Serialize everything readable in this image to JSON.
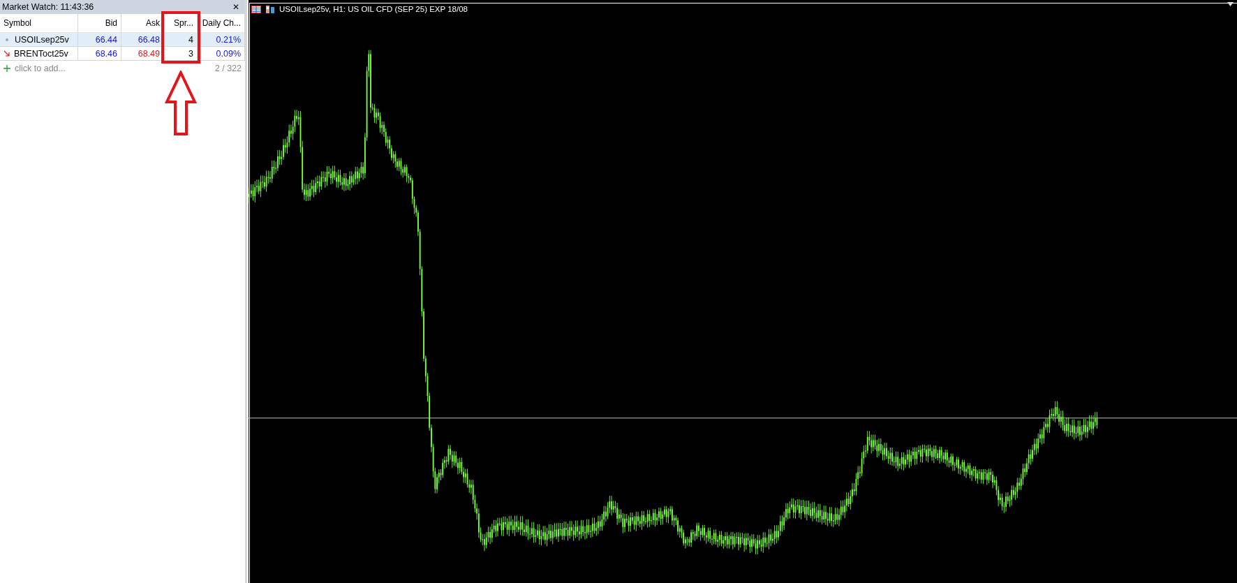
{
  "market_watch": {
    "title": "Market Watch: 11:43:36",
    "close_glyph": "✕",
    "columns": [
      {
        "label": "Symbol",
        "highlighted": false
      },
      {
        "label": "Bid",
        "highlighted": false
      },
      {
        "label": "Ask",
        "highlighted": false
      },
      {
        "label": "Spr...",
        "highlighted": true
      },
      {
        "label": "Daily Ch...",
        "highlighted": false
      }
    ],
    "rows": [
      {
        "symbol": "USOILsep25v",
        "kind": "dot",
        "bid": "66.44",
        "ask": {
          "value": "66.48",
          "color": "#1818c8"
        },
        "spread": "4",
        "change": "0.21%",
        "selected": true
      },
      {
        "symbol": "BRENToct25v",
        "kind": "arrow",
        "bid": "68.46",
        "ask": {
          "value": "68.49",
          "color": "#e4141b"
        },
        "spread": "3",
        "change": "0.09%",
        "selected": false
      }
    ],
    "add_row": {
      "label": "click to add...",
      "count": "2 / 322"
    }
  },
  "chart": {
    "title": "USOILsep25v, H1:  US OIL CFD (SEP 25) EXP 18/08"
  }
}
